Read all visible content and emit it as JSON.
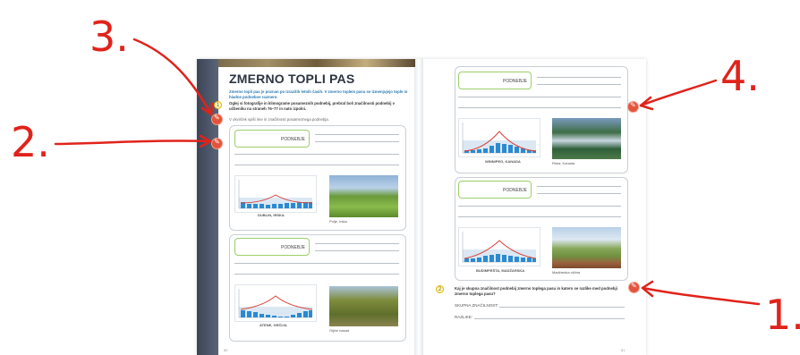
{
  "annotations": {
    "n1": "1.",
    "n2": "2.",
    "n3": "3.",
    "n4": "4."
  },
  "left_page": {
    "title": "ZMERNO TOPLI PAS",
    "intro": "Zmerno topli pas je poznan po izrazitih letnih časih. V zmerno toplem pasu se izmenjujejo tople in hladne podnebne razmere.",
    "task_number": "1",
    "task_text": "Oglej si fotografije in klimograme posameznih podnebij, prebral boš značilnosti podnebij v učbeniku na straneh 76–77 in nato izpolni.",
    "task_hint": "V okvirček vpiši ime in značilnosti posameznega podnebja.",
    "cards": [
      {
        "tag": "PODNEBJE",
        "chart_caption": "DUBLIN, IRSKA",
        "photo_caption": "Polje, Irska"
      },
      {
        "tag": "PODNEBJE",
        "chart_caption": "ATENE, GRČIJA",
        "photo_caption": "Oljčni nasad"
      }
    ],
    "page_number": "80"
  },
  "right_page": {
    "cards": [
      {
        "tag": "PODNEBJE",
        "chart_caption": "WINNIPEG, KANADA",
        "photo_caption": "Reka, Kanada"
      },
      {
        "tag": "PODNEBJE",
        "chart_caption": "BUDIMPEŠTA, MADŽARSKA",
        "photo_caption": "Madžarska nižina"
      }
    ],
    "task_number": "2",
    "task_text": "Kaj je skupna značilnost podnebij zmerno toplega pasu in katero se razlike med podnebji zmerno toplega pasu?",
    "answer1_label": "SKUPNA ZNAČILNOST:",
    "answer2_label": "RAZLIKE:",
    "page_number": "81"
  },
  "colors": {
    "annotation": "#e0231b",
    "accent_blue": "#2a8ad1",
    "accent_green": "#9ccf6a",
    "icon_orange": "#e2553b"
  }
}
